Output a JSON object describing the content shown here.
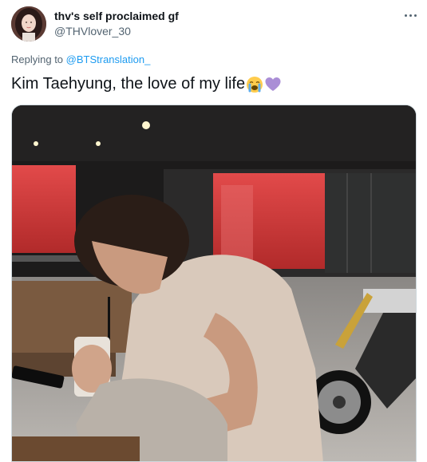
{
  "author": {
    "display_name": "thv's self proclaimed gf",
    "handle": "@THVlover_30"
  },
  "reply": {
    "prefix": "Replying to ",
    "target": "@BTStranslation_"
  },
  "tweet": {
    "text": "Kim Taehyung, the love of my life",
    "emojis": [
      "loudly-crying-face-icon",
      "purple-heart-icon"
    ]
  },
  "media": {
    "description_alt": "Photo"
  },
  "colors": {
    "link": "#1d9bf0",
    "secondary_text": "#536471",
    "primary_text": "#0f1419"
  }
}
